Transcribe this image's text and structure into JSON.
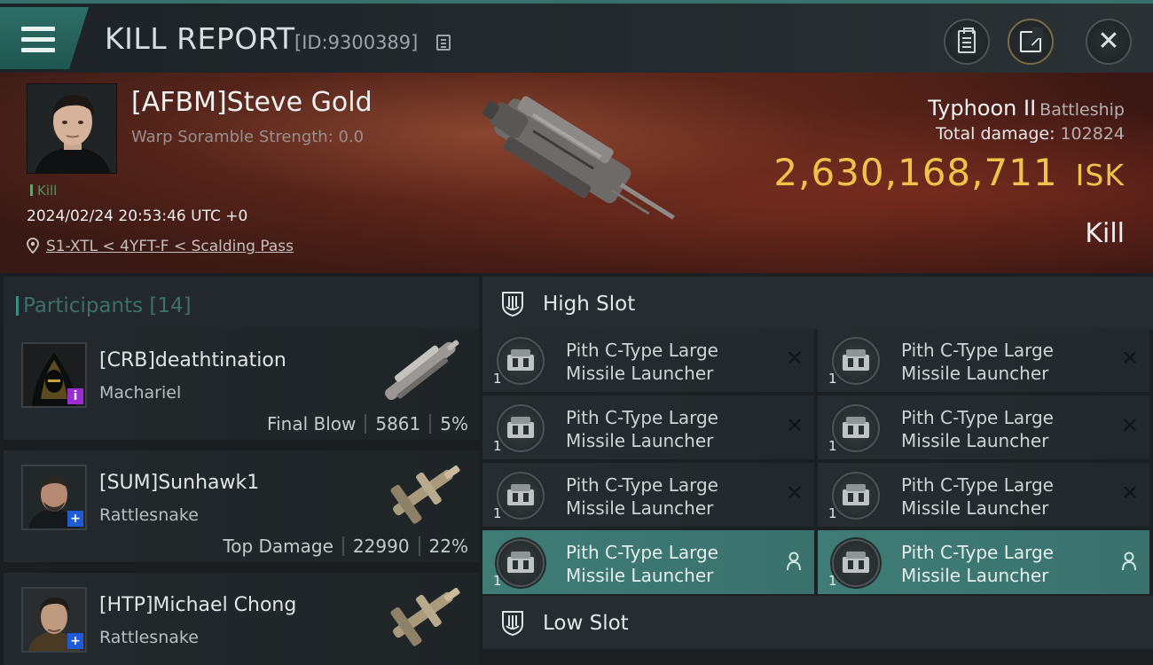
{
  "header": {
    "title": "KILL REPORT",
    "report_id": "[ID:9300389]",
    "icons": [
      "menu-icon",
      "copy-icon",
      "clipboard-icon",
      "share-icon",
      "close-icon"
    ]
  },
  "victim": {
    "name": "[AFBM]Steve Gold",
    "warp_scramble": "Warp Soramble Strength: 0.0",
    "tag": "Kill",
    "timestamp": "2024/02/24 20:53:46 UTC +0",
    "location": "S1-XTL < 4YFT-F < Scalding Pass",
    "ship": "Typhoon II",
    "ship_class": "Battleship",
    "total_damage_label": "Total damage:",
    "total_damage": "102824",
    "isk_value": "2,630,168,711",
    "isk_unit": "ISK",
    "result": "Kill"
  },
  "participants": {
    "title": "Participants",
    "count": "[14]",
    "items": [
      {
        "name": "[CRB]deathtination",
        "ship": "Machariel",
        "label": "Final Blow",
        "damage": "5861",
        "percent": "5%"
      },
      {
        "name": "[SUM]Sunhawk1",
        "ship": "Rattlesnake",
        "label": "Top Damage",
        "damage": "22990",
        "percent": "22%"
      },
      {
        "name": "[HTP]Michael Chong",
        "ship": "Rattlesnake"
      }
    ]
  },
  "slots": {
    "high_title": "High Slot",
    "low_title": "Low Slot",
    "modules": [
      {
        "line1": "Pith C-Type Large",
        "line2": "Missile Launcher",
        "qty": "1",
        "state": "destroyed"
      },
      {
        "line1": "Pith C-Type Large",
        "line2": "Missile Launcher",
        "qty": "1",
        "state": "destroyed"
      },
      {
        "line1": "Pith C-Type Large",
        "line2": "Missile Launcher",
        "qty": "1",
        "state": "destroyed"
      },
      {
        "line1": "Pith C-Type Large",
        "line2": "Missile Launcher",
        "qty": "1",
        "state": "destroyed"
      },
      {
        "line1": "Pith C-Type Large",
        "line2": "Missile Launcher",
        "qty": "1",
        "state": "destroyed"
      },
      {
        "line1": "Pith C-Type Large",
        "line2": "Missile Launcher",
        "qty": "1",
        "state": "destroyed"
      },
      {
        "line1": "Pith C-Type Large",
        "line2": "Missile Launcher",
        "qty": "1",
        "state": "dropped"
      },
      {
        "line1": "Pith C-Type Large",
        "line2": "Missile Launcher",
        "qty": "1",
        "state": "dropped"
      }
    ]
  },
  "colors": {
    "accent_teal": "#3f7c76",
    "isk_gold": "#f0c24a",
    "banner_red": "#5a261a"
  }
}
